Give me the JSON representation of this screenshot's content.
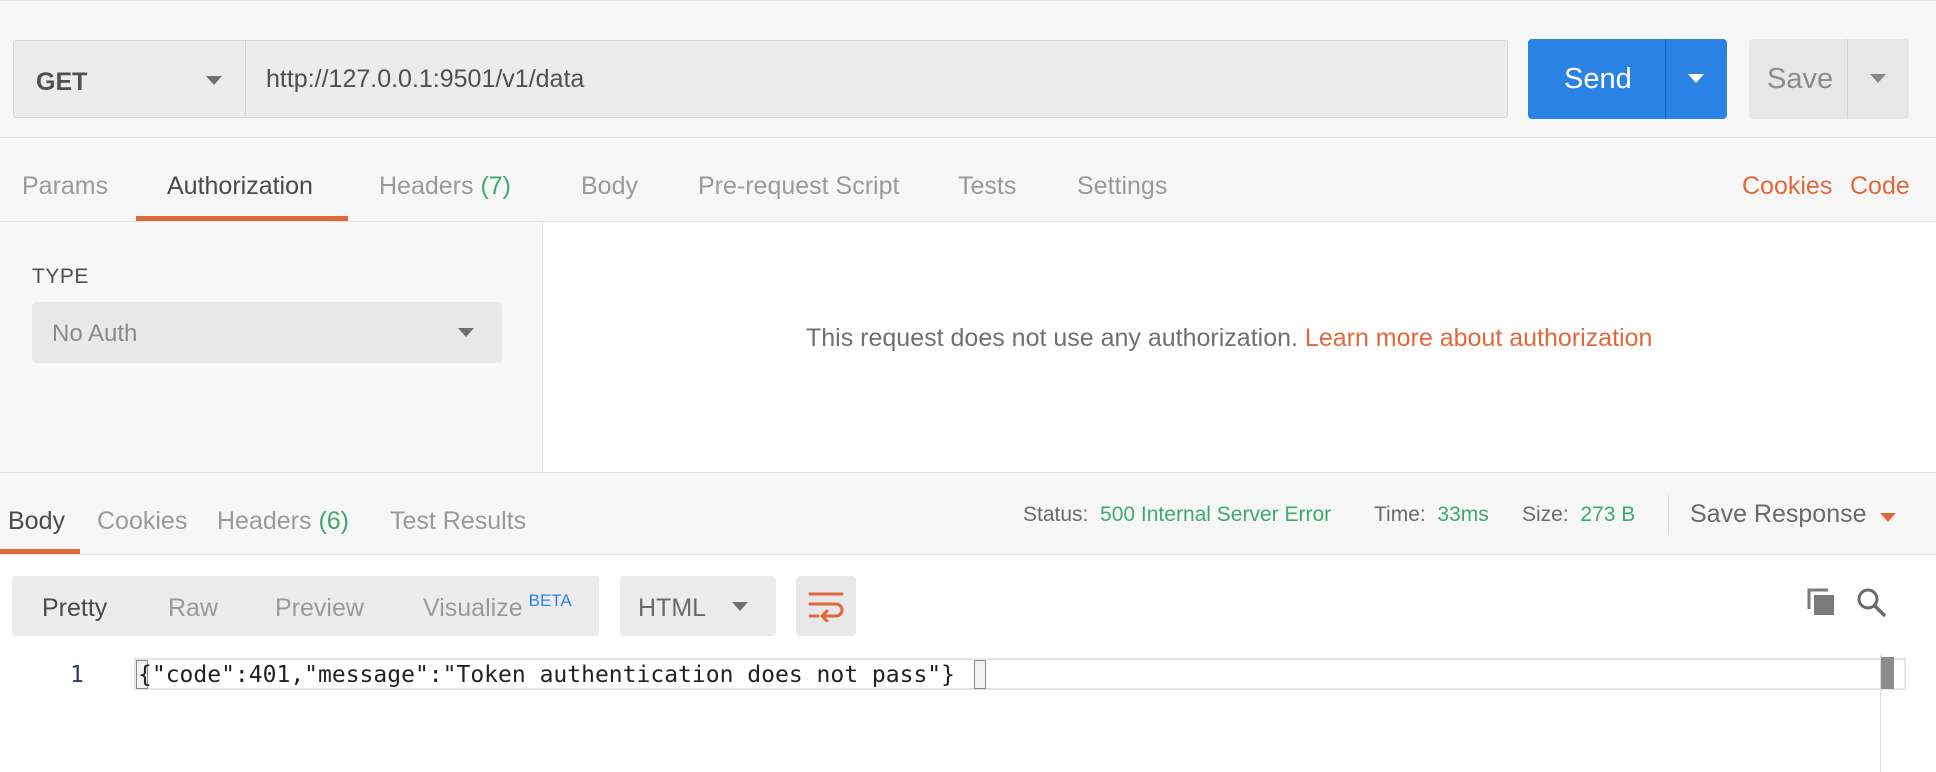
{
  "request": {
    "method": "GET",
    "url": "http://127.0.0.1:9501/v1/data",
    "send_label": "Send",
    "save_label": "Save"
  },
  "request_tabs": [
    {
      "label": "Params",
      "count": "",
      "active": false
    },
    {
      "label": "Authorization",
      "count": "",
      "active": true
    },
    {
      "label": "Headers",
      "count": "(7)",
      "active": false
    },
    {
      "label": "Body",
      "count": "",
      "active": false
    },
    {
      "label": "Pre-request Script",
      "count": "",
      "active": false
    },
    {
      "label": "Tests",
      "count": "",
      "active": false
    },
    {
      "label": "Settings",
      "count": "",
      "active": false
    }
  ],
  "request_links": {
    "cookies": "Cookies",
    "code": "Code"
  },
  "auth": {
    "type_label": "TYPE",
    "selected_type": "No Auth",
    "message": "This request does not use any authorization.",
    "learn_more": "Learn more about authorization"
  },
  "response_tabs": [
    {
      "label": "Body",
      "count": "",
      "active": true
    },
    {
      "label": "Cookies",
      "count": "",
      "active": false
    },
    {
      "label": "Headers",
      "count": "(6)",
      "active": false
    },
    {
      "label": "Test Results",
      "count": "",
      "active": false
    }
  ],
  "status": {
    "status_label": "Status:",
    "status_value": "500 Internal Server Error",
    "time_label": "Time:",
    "time_value": "33ms",
    "size_label": "Size:",
    "size_value": "273 B",
    "save_response": "Save Response"
  },
  "view_modes": [
    {
      "label": "Pretty",
      "active": true
    },
    {
      "label": "Raw",
      "active": false
    },
    {
      "label": "Preview",
      "active": false
    },
    {
      "label": "Visualize",
      "active": false,
      "badge": "BETA"
    }
  ],
  "language": "HTML",
  "editor": {
    "line_number": "1",
    "code": "{\"code\":401,\"message\":\"Token authentication does not pass\"}"
  },
  "colors": {
    "accent": "#e0693c",
    "send_blue": "#2a82e4",
    "success_green": "#3daa6f"
  },
  "icons": [
    "chevron-down-icon",
    "wrap-lines-icon",
    "copy-icon",
    "search-icon"
  ]
}
